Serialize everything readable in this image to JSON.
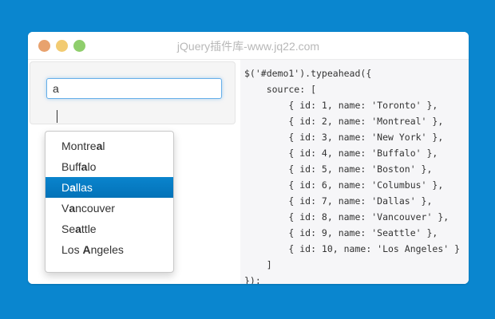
{
  "window": {
    "title": "jQuery插件库-www.jq22.com"
  },
  "demo": {
    "input_value": "a",
    "typed": "a",
    "suggestions": [
      {
        "label": "Montreal",
        "active": false
      },
      {
        "label": "Buffalo",
        "active": false
      },
      {
        "label": "Dallas",
        "active": true
      },
      {
        "label": "Vancouver",
        "active": false
      },
      {
        "label": "Seattle",
        "active": false
      },
      {
        "label": "Los Angeles",
        "active": false
      }
    ]
  },
  "code": {
    "lines": [
      "$('#demo1').typeahead({",
      "    source: [",
      "        { id: 1, name: 'Toronto' },",
      "        { id: 2, name: 'Montreal' },",
      "        { id: 3, name: 'New York' },",
      "        { id: 4, name: 'Buffalo' },",
      "        { id: 5, name: 'Boston' },",
      "        { id: 6, name: 'Columbus' },",
      "        { id: 7, name: 'Dallas' },",
      "        { id: 8, name: 'Vancouver' },",
      "        { id: 9, name: 'Seattle' },",
      "        { id: 10, name: 'Los Angeles' }",
      "    ]",
      "});"
    ]
  },
  "colors": {
    "page_background": "#0a86cf",
    "highlight": "#0a84cd",
    "code_background": "#f6f6f8",
    "input_focus_border": "#66afe9"
  }
}
